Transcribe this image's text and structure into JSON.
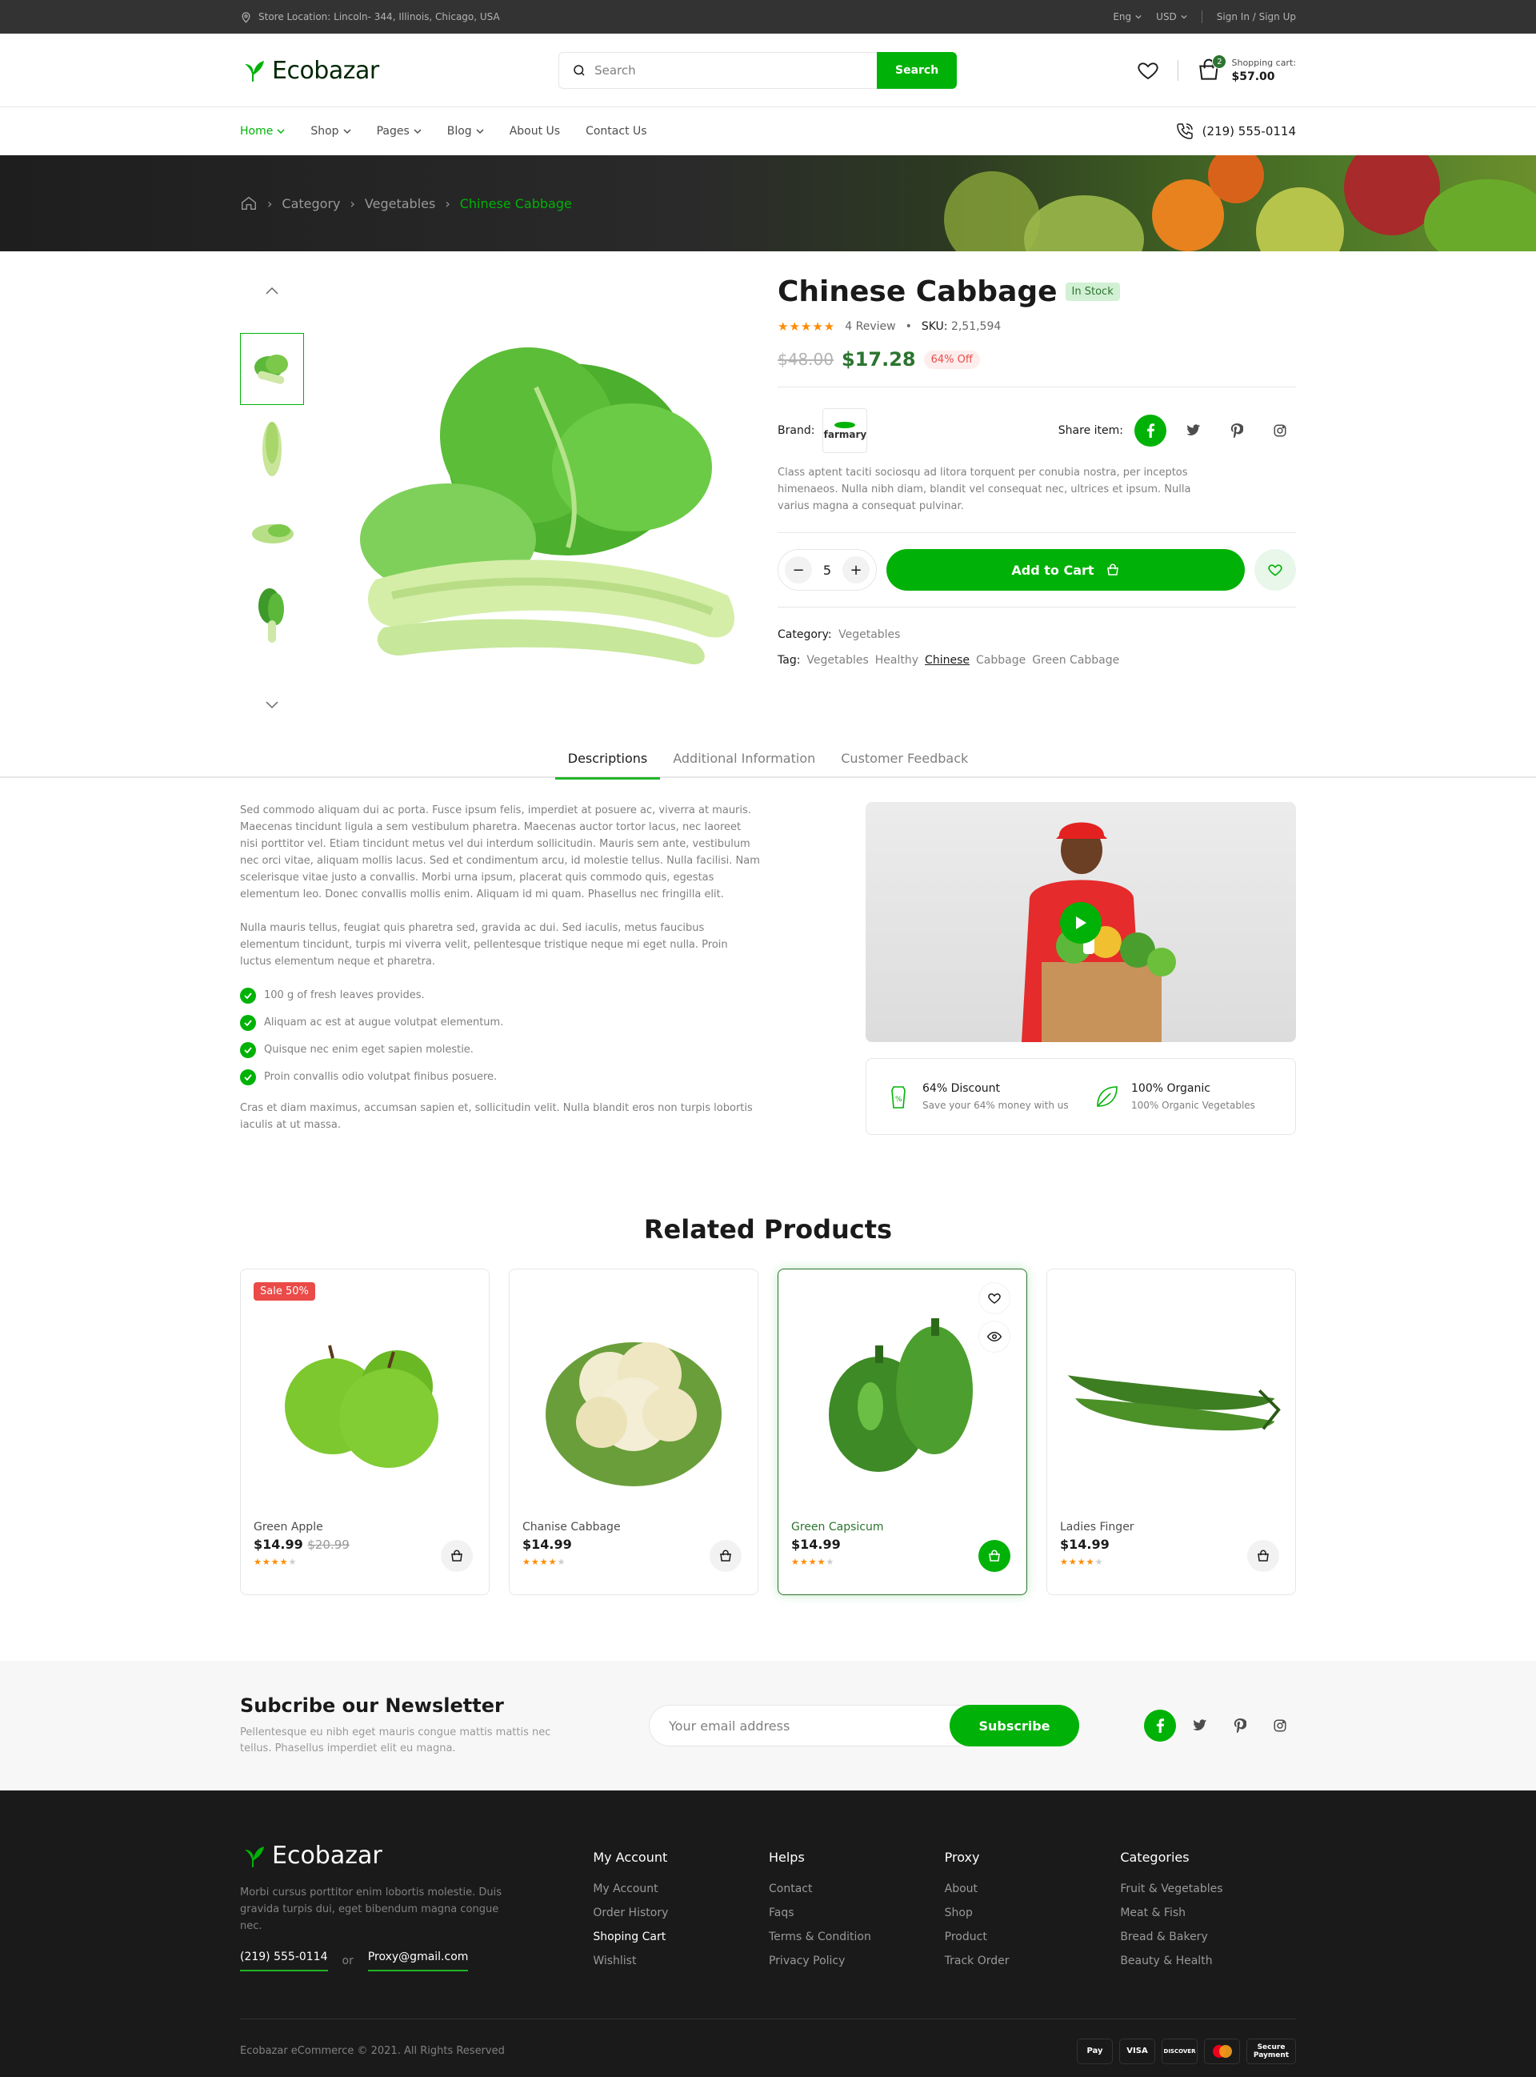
{
  "topbar": {
    "location": "Store Location: Lincoln- 344, Illinois, Chicago, USA",
    "language": "Eng",
    "currency": "USD",
    "auth": "Sign In / Sign Up"
  },
  "header": {
    "logo": "Ecobazar",
    "search_placeholder": "Search",
    "search_button": "Search",
    "cart_count": "2",
    "cart_label": "Shopping cart:",
    "cart_amount": "$57.00"
  },
  "nav": {
    "items": [
      {
        "label": "Home"
      },
      {
        "label": "Shop"
      },
      {
        "label": "Pages"
      },
      {
        "label": "Blog"
      },
      {
        "label": "About Us"
      },
      {
        "label": "Contact Us"
      }
    ],
    "phone": "(219) 555-0114"
  },
  "breadcrumb": {
    "items": [
      "Category",
      "Vegetables"
    ],
    "current": "Chinese Cabbage"
  },
  "product": {
    "title": "Chinese Cabbage",
    "stock": "In Stock",
    "rating": 5,
    "reviews": "4 Review",
    "sku_label": "SKU:",
    "sku": "2,51,594",
    "old_price": "$48.00",
    "price": "$17.28",
    "discount": "64% Off",
    "brand_label": "Brand:",
    "brand": "farmary",
    "share_label": "Share item:",
    "description": "Class aptent taciti sociosqu ad litora torquent per conubia nostra, per inceptos himenaeos. Nulla nibh diam, blandit vel consequat nec, ultrices et ipsum. Nulla varius magna a consequat pulvinar.",
    "quantity": "5",
    "add_to_cart": "Add to Cart",
    "category_label": "Category:",
    "category": "Vegetables",
    "tag_label": "Tag:",
    "tags": [
      "Vegetables",
      "Healthy",
      "Chinese",
      "Cabbage",
      "Green Cabbage"
    ]
  },
  "tabs": [
    "Descriptions",
    "Additional Information",
    "Customer Feedback"
  ],
  "details": {
    "para1": "Sed commodo aliquam dui ac porta. Fusce ipsum felis, imperdiet at posuere ac, viverra at mauris. Maecenas tincidunt ligula a sem vestibulum pharetra. Maecenas auctor tortor lacus, nec laoreet nisi porttitor vel. Etiam tincidunt metus vel dui interdum sollicitudin. Mauris sem ante, vestibulum nec orci vitae, aliquam mollis lacus. Sed et condimentum arcu, id molestie tellus. Nulla facilisi. Nam scelerisque vitae justo a convallis. Morbi urna ipsum, placerat quis commodo quis, egestas elementum leo. Donec convallis mollis enim. Aliquam id mi quam. Phasellus nec fringilla elit.",
    "para2": "Nulla mauris tellus, feugiat quis pharetra sed, gravida ac dui. Sed iaculis, metus faucibus elementum tincidunt, turpis mi viverra velit, pellentesque tristique neque mi eget nulla. Proin luctus elementum neque et pharetra.",
    "checks": [
      "100 g of fresh leaves provides.",
      "Aliquam ac est at augue volutpat elementum.",
      "Quisque nec enim eget sapien molestie.",
      "Proin convallis odio volutpat finibus posuere."
    ],
    "para3": "Cras et diam maximus, accumsan sapien et, sollicitudin velit. Nulla blandit eros non turpis lobortis iaculis at ut massa.",
    "feature1_title": "64% Discount",
    "feature1_sub": "Save your 64% money with us",
    "feature2_title": "100% Organic",
    "feature2_sub": "100% Organic Vegetables"
  },
  "related": {
    "title": "Related Products",
    "products": [
      {
        "name": "Green Apple",
        "price": "$14.99",
        "old_price": "$20.99",
        "badge": "Sale 50%",
        "rating": 4
      },
      {
        "name": "Chanise Cabbage",
        "price": "$14.99",
        "rating": 4
      },
      {
        "name": "Green Capsicum",
        "price": "$14.99",
        "rating": 4
      },
      {
        "name": "Ladies Finger",
        "price": "$14.99",
        "rating": 4
      }
    ]
  },
  "newsletter": {
    "title": "Subcribe our Newsletter",
    "subtitle": "Pellentesque eu nibh eget mauris congue mattis mattis nec tellus. Phasellus imperdiet elit eu magna.",
    "placeholder": "Your email address",
    "button": "Subscribe"
  },
  "footer": {
    "logo": "Ecobazar",
    "about": "Morbi cursus porttitor enim lobortis molestie. Duis gravida turpis dui, eget bibendum magna congue nec.",
    "phone": "(219) 555-0114",
    "or": "or",
    "email": "Proxy@gmail.com",
    "columns": [
      {
        "title": "My Account",
        "links": [
          "My Account",
          "Order History",
          "Shoping Cart",
          "Wishlist"
        ]
      },
      {
        "title": "Helps",
        "links": [
          "Contact",
          "Faqs",
          "Terms & Condition",
          "Privacy Policy"
        ]
      },
      {
        "title": "Proxy",
        "links": [
          "About",
          "Shop",
          "Product",
          "Track Order"
        ]
      },
      {
        "title": "Categories",
        "links": [
          "Fruit & Vegetables",
          "Meat & Fish",
          "Bread & Bakery",
          "Beauty & Health"
        ]
      }
    ],
    "copyright": "Ecobazar eCommerce © 2021. All Rights Reserved",
    "payments": [
      "Pay",
      "VISA",
      "DISCOVER",
      "mastercard",
      "Secure Payment"
    ]
  },
  "colors": {
    "brand": "#00b207",
    "dark_green": "#2c742f",
    "sale": "#ea4b48",
    "star": "#ff8a00"
  }
}
